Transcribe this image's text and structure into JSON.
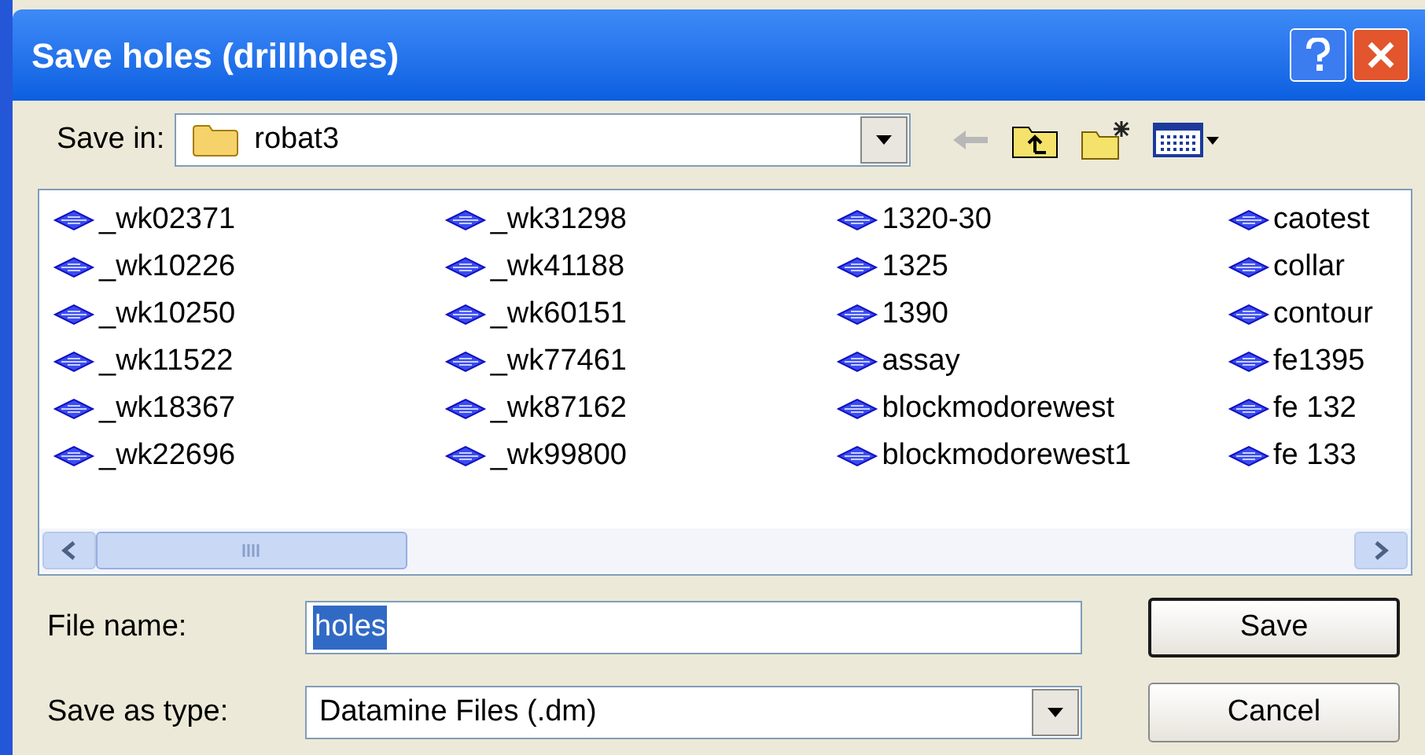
{
  "window": {
    "title": "Save holes (drillholes)"
  },
  "save_in": {
    "label": "Save in:",
    "folder": "robat3"
  },
  "files": [
    {
      "name": "_wk02371"
    },
    {
      "name": "_wk10226"
    },
    {
      "name": "_wk10250"
    },
    {
      "name": "_wk11522"
    },
    {
      "name": "_wk18367"
    },
    {
      "name": "_wk22696"
    },
    {
      "name": "_wk31298"
    },
    {
      "name": "_wk41188"
    },
    {
      "name": "_wk60151"
    },
    {
      "name": "_wk77461"
    },
    {
      "name": "_wk87162"
    },
    {
      "name": "_wk99800"
    },
    {
      "name": "1320-30"
    },
    {
      "name": "1325"
    },
    {
      "name": "1390"
    },
    {
      "name": "assay"
    },
    {
      "name": "blockmodorewest"
    },
    {
      "name": "blockmodorewest1"
    },
    {
      "name": "caotest"
    },
    {
      "name": "collar"
    },
    {
      "name": "contour"
    },
    {
      "name": "fe1395"
    },
    {
      "name": "fe 132"
    },
    {
      "name": "fe 133"
    }
  ],
  "file_name": {
    "label": "File name:",
    "value": "holes",
    "selected": true
  },
  "save_as_type": {
    "label": "Save as type:",
    "value": "Datamine Files (.dm)"
  },
  "buttons": [
    {
      "label": "Save",
      "default": true
    },
    {
      "label": "Cancel",
      "default": false
    }
  ]
}
